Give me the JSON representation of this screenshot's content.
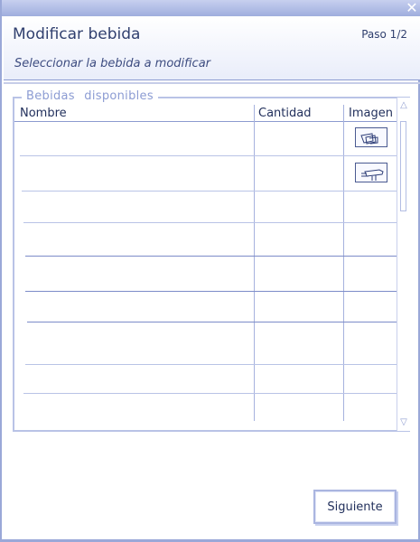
{
  "window": {
    "close_icon": "close-icon"
  },
  "header": {
    "title": "Modificar bebida",
    "step": "Paso 1/2",
    "subtitle": "Seleccionar la bebida a modificar"
  },
  "group": {
    "legend": "Bebidas disponibles"
  },
  "table": {
    "columns": [
      "Nombre",
      "Cantidad",
      "Imagen"
    ],
    "rows": [
      {
        "nombre": "",
        "cantidad": "",
        "imagen_icon": "glasses-icon"
      },
      {
        "nombre": "",
        "cantidad": "",
        "imagen_icon": "bottle-pour-icon"
      },
      {
        "nombre": "",
        "cantidad": "",
        "imagen_icon": ""
      },
      {
        "nombre": "",
        "cantidad": "",
        "imagen_icon": ""
      },
      {
        "nombre": "",
        "cantidad": "",
        "imagen_icon": ""
      },
      {
        "nombre": "",
        "cantidad": "",
        "imagen_icon": ""
      },
      {
        "nombre": "",
        "cantidad": "",
        "imagen_icon": ""
      },
      {
        "nombre": "",
        "cantidad": "",
        "imagen_icon": ""
      },
      {
        "nombre": "",
        "cantidad": "",
        "imagen_icon": ""
      },
      {
        "nombre": "",
        "cantidad": "",
        "imagen_icon": ""
      }
    ]
  },
  "scrollbar": {
    "up_glyph": "△",
    "down_glyph": "▽"
  },
  "footer": {
    "next_label": "Siguiente"
  },
  "colors": {
    "accent": "#9aa8d8",
    "text": "#31406f",
    "legend": "#8c9cd3"
  }
}
